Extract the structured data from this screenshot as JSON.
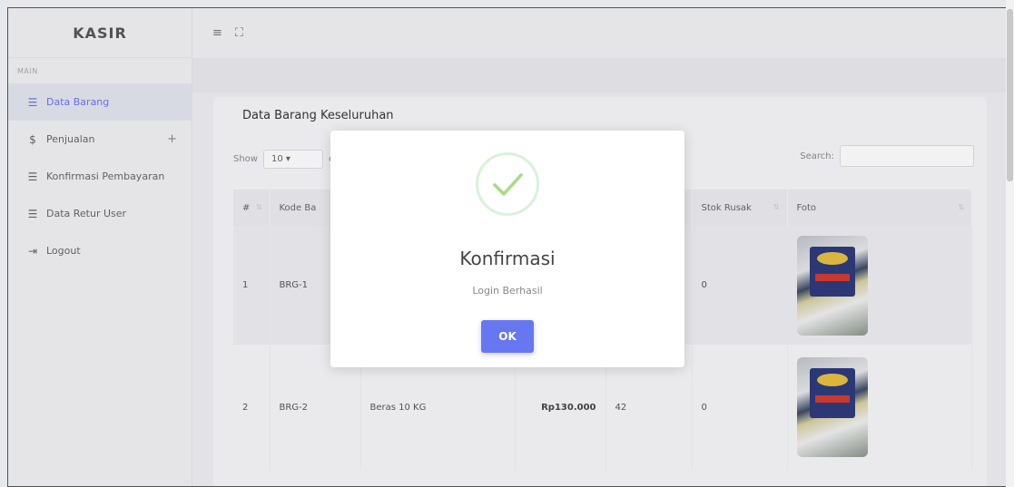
{
  "sidebar": {
    "brand": "KASIR",
    "section_label": "MAIN",
    "items": [
      {
        "label": "Data Barang",
        "icon": "list-icon",
        "glyph": "☰",
        "active": true
      },
      {
        "label": "Penjualan",
        "icon": "dollar-icon",
        "glyph": "$",
        "expandable": "+"
      },
      {
        "label": "Konfirmasi Pembayaran",
        "icon": "list-icon",
        "glyph": "☰"
      },
      {
        "label": "Data Retur User",
        "icon": "list-icon",
        "glyph": "☰"
      },
      {
        "label": "Logout",
        "icon": "logout-icon",
        "glyph": "⇥"
      }
    ]
  },
  "topbar": {
    "menu_glyph": "≡",
    "fullscreen_glyph": "⛶"
  },
  "card": {
    "title": "Data Barang Keseluruhan",
    "show_label": "Show",
    "show_value": "10",
    "entries_partial": "en",
    "search_label": "Search:",
    "columns": [
      "#",
      "Kode Ba",
      "",
      "",
      "",
      "Stok Rusak",
      "Foto"
    ],
    "rows": [
      {
        "no": "1",
        "kode": "BRG-1",
        "nama": "",
        "harga": "",
        "stok": "",
        "rusak": "0"
      },
      {
        "no": "2",
        "kode": "BRG-2",
        "nama": "Beras 10 KG",
        "harga": "Rp130.000",
        "stok": "42",
        "rusak": "0"
      }
    ]
  },
  "modal": {
    "title": "Konfirmasi",
    "text": "Login Berhasil",
    "ok_label": "OK"
  },
  "colors": {
    "accent": "#6777ef",
    "success": "#a5dc86"
  }
}
